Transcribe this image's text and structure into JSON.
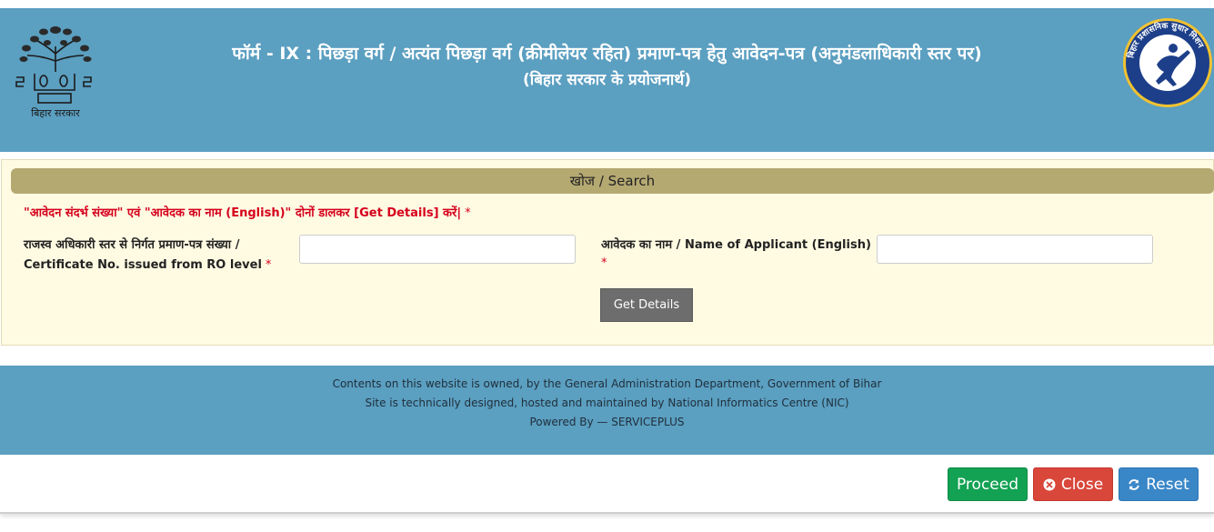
{
  "header": {
    "title_line1": "फॉर्म - IX : पिछड़ा वर्ग / अत्यंत पिछड़ा वर्ग (क्रीमीलेयर रहित) प्रमाण-पत्र हेतु आवेदन-पत्र (अनुमंडलाधिकारी स्तर पर)",
    "title_line2": "(बिहार सरकार के प्रयोजनार्थ)",
    "left_logo_caption": "बिहार सरकार",
    "left_logo_icon": "bihar-emblem-bodhi-tree-icon",
    "right_logo_text": "बिहार प्रशासनिक सुधार मिशन",
    "right_logo_icon": "bihar-admin-reform-mission-icon"
  },
  "search": {
    "heading": "खोज / Search",
    "instruction": "\"आवेदन संदर्भ संख्या\" एवं \"आवेदक का नाम (English)\" दोनों डालकर [Get Details] करें|",
    "required_mark": "*",
    "certificate_label_line1": "राजस्व अधिकारी स्तर से निर्गत प्रमाण-पत्र संख्या /",
    "certificate_label_line2": "Certificate No. issued from RO level",
    "certificate_value": "",
    "applicant_label": "आवेदक का नाम / Name of Applicant (English)",
    "applicant_value": "",
    "get_details_label": "Get Details"
  },
  "footer": {
    "line1": "Contents on this website is owned, by the General Administration Department, Government of Bihar",
    "line2": "Site is technically designed, hosted and maintained by National Informatics Centre (NIC)",
    "line3": "Powered By — SERVICEPLUS"
  },
  "actions": {
    "proceed_label": "Proceed",
    "close_label": "Close",
    "reset_label": "Reset",
    "close_icon": "times-circle-icon",
    "reset_icon": "refresh-icon"
  },
  "colors": {
    "header_bg": "#5b9fc1",
    "panel_bg": "#fffbe3",
    "panel_heading_bg": "#b5a972",
    "instruction_red": "#d6001c",
    "proceed_green": "#13a253",
    "close_red": "#d9463a",
    "reset_blue": "#3a87c8"
  }
}
